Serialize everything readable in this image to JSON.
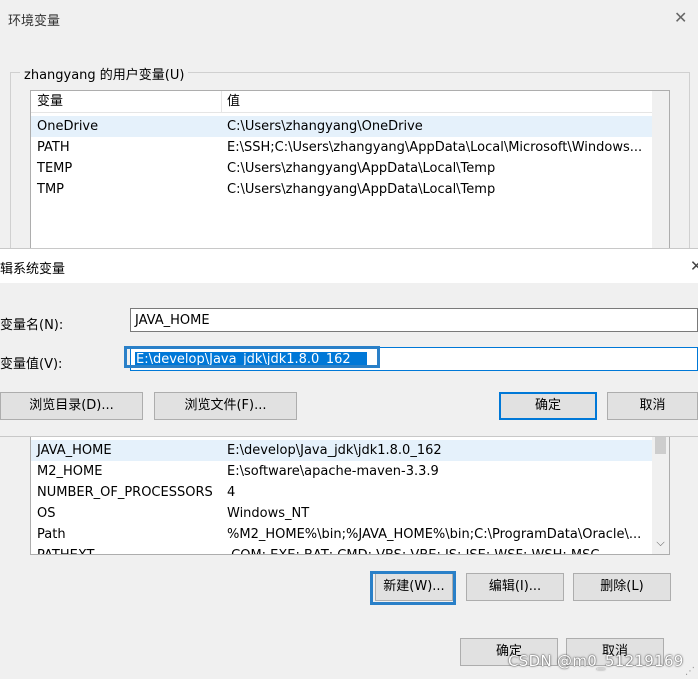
{
  "env_dialog": {
    "title": "环境变量",
    "close_glyph": "✕",
    "user_group_label": "zhangyang 的用户变量(U)",
    "user_list": {
      "header": {
        "col1": "变量",
        "col2": "值"
      },
      "rows": [
        {
          "name": "OneDrive",
          "value": "C:\\Users\\zhangyang\\OneDrive"
        },
        {
          "name": "PATH",
          "value": "E:\\SSH;C:\\Users\\zhangyang\\AppData\\Local\\Microsoft\\Windows..."
        },
        {
          "name": "TEMP",
          "value": "C:\\Users\\zhangyang\\AppData\\Local\\Temp"
        },
        {
          "name": "TMP",
          "value": "C:\\Users\\zhangyang\\AppData\\Local\\Temp"
        }
      ]
    },
    "system_list": {
      "rows": [
        {
          "name": "JAVA_HOME",
          "value": "E:\\develop\\Java_jdk\\jdk1.8.0_162"
        },
        {
          "name": "M2_HOME",
          "value": "E:\\software\\apache-maven-3.3.9"
        },
        {
          "name": "NUMBER_OF_PROCESSORS",
          "value": "4"
        },
        {
          "name": "OS",
          "value": "Windows_NT"
        },
        {
          "name": "Path",
          "value": "%M2_HOME%\\bin;%JAVA_HOME%\\bin;C:\\ProgramData\\Oracle\\..."
        },
        {
          "name": "PATHEXT",
          "value": ".COM;.EXE;.BAT;.CMD;.VBS;.VBE;.JS;.JSE;.WSF;.WSH;.MSC"
        }
      ]
    },
    "buttons": {
      "new": "新建(W)...",
      "edit": "编辑(I)...",
      "delete": "删除(L)",
      "ok": "确定",
      "cancel": "取消"
    }
  },
  "edit_dialog": {
    "title": "辑系统变量",
    "close_glyph": "✕",
    "name_label": "变量名(N):",
    "value_label": "变量值(V):",
    "name_value": "JAVA_HOME",
    "value_value": "E:\\develop\\Java_jdk\\jdk1.8.0_162",
    "buttons": {
      "browse_dir": "浏览目录(D)...",
      "browse_file": "浏览文件(F)...",
      "ok": "确定",
      "cancel": "取消"
    }
  },
  "watermark": "CSDN @m0_51219169",
  "icons": {
    "scroll_down": "chevron-down-icon",
    "resize": "resize-grip-icon"
  }
}
